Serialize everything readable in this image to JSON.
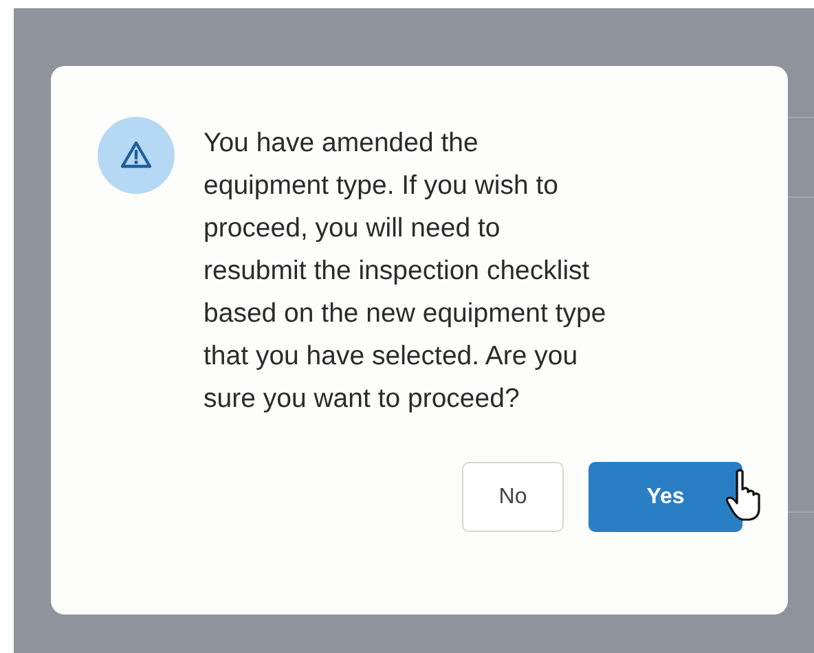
{
  "dialog": {
    "message_lines": [
      "You have amended the",
      "equipment type. If you wish to",
      "proceed, you will need to",
      "resubmit the inspection checklist",
      "based on the new equipment type",
      "that you have selected. Are you",
      "sure you want to proceed?"
    ],
    "buttons": [
      {
        "label": "No",
        "kind": "secondary"
      },
      {
        "label": "Yes",
        "kind": "primary"
      }
    ]
  }
}
